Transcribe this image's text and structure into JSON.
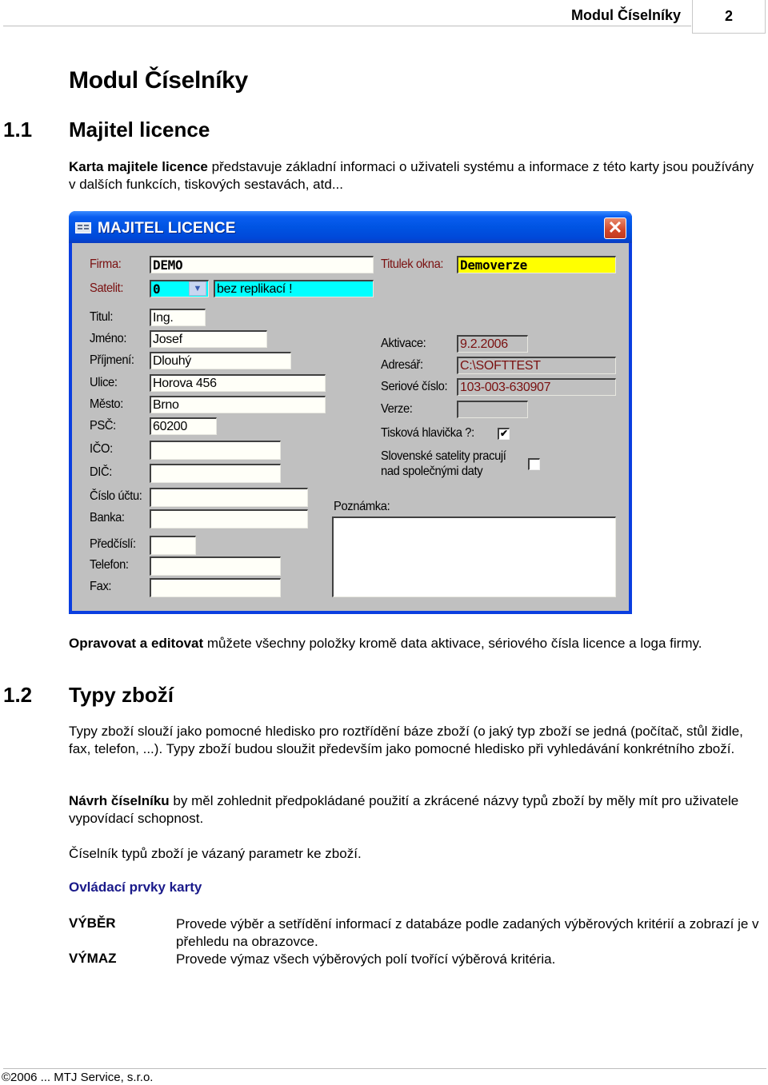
{
  "header": {
    "title": "Modul Číselníky",
    "page_number": "2"
  },
  "document": {
    "title": "Modul Číselníky",
    "section_1_1": {
      "number": "1.1",
      "title": "Majitel licence",
      "intro_bold": "Karta majitele licence",
      "intro_text": " představuje základní informaci o uživateli systému a informace z této karty jsou používány v dalších funkcích, tiskových sestavách, atd...",
      "note_bold": "Opravovat a editovat",
      "note_text": " můžete všechny položky kromě data aktivace, sériového čísla licence a loga firmy."
    },
    "section_1_2": {
      "number": "1.2",
      "title": "Typy zboží",
      "para1": "Typy zboží slouží jako pomocné hledisko pro roztřídění báze zboží (o jaký typ zboží se jedná (počítač, stůl židle, fax, telefon, ...). Typy zboží budou sloužit především jako pomocné hledisko při vyhledávání konkrétního zboží.",
      "para2_bold": "Návrh číselníku",
      "para2_text": " by měl zohlednit předpokládané použití a zkrácené názvy typů zboží by měly mít pro uživatele vypovídací schopnost.",
      "para3": "Číselník typů zboží je vázaný parametr ke zboží.",
      "controls_heading": "Ovládací prvky karty",
      "controls": [
        {
          "term": "VÝBĚR",
          "description": "Provede výběr a setřídění informací z databáze podle zadaných výběrových kritérií a zobrazí je v přehledu na obrazovce."
        },
        {
          "term": "VÝMAZ",
          "description": "Provede výmaz všech výběrových polí tvořící výběrová kritéria."
        }
      ]
    }
  },
  "window": {
    "title": "MAJITEL LICENCE",
    "close_icon": "close-icon",
    "left_fields": {
      "firma": {
        "label": "Firma:",
        "value": "DEMO"
      },
      "satelit": {
        "label": "Satelit:",
        "value": "0",
        "description": "bez replikací !"
      },
      "titul": {
        "label": "Titul:",
        "value": "Ing."
      },
      "jmeno": {
        "label": "Jméno:",
        "value": "Josef"
      },
      "prijmeni": {
        "label": "Příjmení:",
        "value": "Dlouhý"
      },
      "ulice": {
        "label": "Ulice:",
        "value": "Horova 456"
      },
      "mesto": {
        "label": "Město:",
        "value": "Brno"
      },
      "psc": {
        "label": "PSČ:",
        "value": "60200"
      },
      "ico": {
        "label": "IČO:",
        "value": ""
      },
      "dic": {
        "label": "DIČ:",
        "value": ""
      },
      "cislo_uctu": {
        "label": "Číslo účtu:",
        "value": ""
      },
      "banka": {
        "label": "Banka:",
        "value": ""
      },
      "predcisli": {
        "label": "Předčíslí:",
        "value": ""
      },
      "telefon": {
        "label": "Telefon:",
        "value": ""
      },
      "fax": {
        "label": "Fax:",
        "value": ""
      }
    },
    "right_fields": {
      "titulek_okna": {
        "label": "Titulek okna:",
        "value": "Demoverze"
      },
      "aktivace": {
        "label": "Aktivace:",
        "value": "9.2.2006"
      },
      "adresar": {
        "label": "Adresář:",
        "value": "C:\\SOFTTEST"
      },
      "seriove_cislo": {
        "label": "Seriové číslo:",
        "value": "103-003-630907"
      },
      "verze": {
        "label": "Verze:",
        "value": ""
      },
      "tiskova_hlavicka": {
        "label": "Tisková hlavička ?:",
        "checked": true,
        "mark": "✔"
      },
      "slovenske_satelity": {
        "label_line1": "Slovenské satelity pracují",
        "label_line2": "nad společnými daty",
        "checked": false
      },
      "poznamka": {
        "label": "Poznámka:",
        "value": ""
      }
    }
  },
  "footer": {
    "copyright": "©2006 ... MTJ Service, s.r.o."
  }
}
